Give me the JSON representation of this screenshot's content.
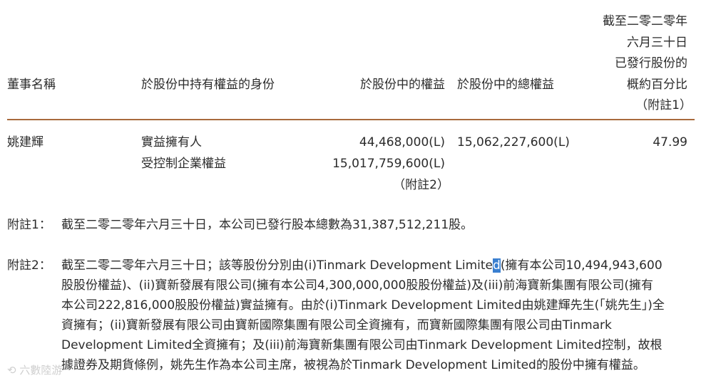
{
  "table": {
    "headers": {
      "director_name": "董事名稱",
      "capacity": "於股份中持有權益的身份",
      "interest": "於股份中的權益",
      "total_interest": "於股份中的總權益",
      "percentage": [
        "截至二零二零年",
        "六月三十日",
        "已發行股份的",
        "概約百分比",
        "（附註1）"
      ]
    },
    "row": {
      "name": "姚建輝",
      "capacity_1": "實益擁有人",
      "capacity_2": "受控制企業權益",
      "interest_1": "44,468,000(L)",
      "interest_2": "15,017,759,600(L)",
      "interest_note": "（附註2）",
      "total_interest": "15,062,227,600(L)",
      "percentage": "47.99"
    }
  },
  "notes": {
    "note1": {
      "label": "附註1：",
      "text": "截至二零二零年六月三十日，本公司已發行股本總數為31,387,512,211股。"
    },
    "note2": {
      "label": "附註2：",
      "lines": [
        "截至二零二零年六月三十日；該等股份分別由(i)Tinmark Development Limite",
        "股股份權益)、(ii)寶新發展有限公司(擁有本公司4,300,000,000股股份權益)及(iii)前海寶新集團有限公司(擁有",
        "本公司222,816,000股股份權益)實益擁有。由於(i)Tinmark Development Limited由姚建輝先生(「姚先生」)全",
        "資擁有；(ii)寶新發展有限公司由寶新國際集團有限公司全資擁有，而寶新國際集團有限公司由Tinmark",
        "Development Limited全資擁有；及(iii)前海寶新集團有限公司由Tinmark Development Limited控制，故根",
        "據證券及期貨條例，姚先生作為本公司主席，被視為於Tinmark Development Limited的股份中擁有權益。"
      ],
      "highlight_char": "d",
      "line1_tail": "(擁有本公司10,494,943,600"
    }
  },
  "watermark": "六數陸游"
}
